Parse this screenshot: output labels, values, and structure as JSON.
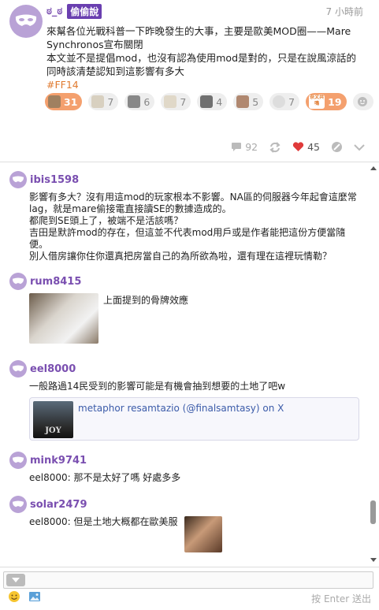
{
  "post": {
    "author": "ಠ_ಠ",
    "qualifier": "偷偷說",
    "time": "7 小時前",
    "lines": [
      "來幫各位光戰科普一下昨晚發生的大事，主要是歐美MOD圈——Mare",
      "Synchronos宣布關閉",
      "本文並不是提倡mod，也沒有認為使用mod是對的，只是在說風涼話的",
      "同時該清楚認知到這影響有多大"
    ],
    "tag": "#FF14",
    "reactions": [
      {
        "count": "31",
        "active": true
      },
      {
        "count": "7",
        "active": false
      },
      {
        "count": "6",
        "active": false
      },
      {
        "count": "7",
        "active": false
      },
      {
        "count": "4",
        "active": false
      },
      {
        "count": "5",
        "active": false
      },
      {
        "count": "7",
        "active": false
      },
      {
        "label": "奈文共鳴",
        "count": "19",
        "active": true
      }
    ],
    "stats": {
      "responses": "92",
      "likes": "45"
    }
  },
  "responses": [
    {
      "user": "ibis1598",
      "lines": [
        "影響有多大？沒有用這mod的玩家根本不影響。NA區的伺服器今年起會這麼常",
        "lag，就是mare偷接電直接讀SE的數據造成的。",
        "都爬到SE頭上了，被端不是活該嗎？",
        "吉田是默許mod的存在，但這並不代表mod用戶或是作者能把這份方便當隨",
        "便。",
        "別人借房讓你住你還真把房當自己的為所欲為啦，還有理在這裡玩情勒？"
      ]
    },
    {
      "user": "rum8415",
      "caption": "上面提到的骨牌效應"
    },
    {
      "user": "eel8000",
      "text": "一般路過14民受到的影響可能是有機會抽到想要的土地了吧w",
      "link_title": "metaphor resamtazio (@finalsamtasy) on X",
      "link_thumb_text": "JOY"
    },
    {
      "user": "mink9741",
      "text": "eel8000: 那不是太好了嗎 好處多多"
    },
    {
      "user": "solar2479",
      "text": "eel8000: 但是土地大概都在歐美服"
    }
  ],
  "input": {
    "send_hint": "按 Enter 送出"
  },
  "colors": {
    "accent": "#7a4fb0",
    "qualifier_bg": "#6a3fb0",
    "tag": "#e07a2f",
    "reaction_active": "#f4a06e",
    "like": "#e03a3a"
  }
}
